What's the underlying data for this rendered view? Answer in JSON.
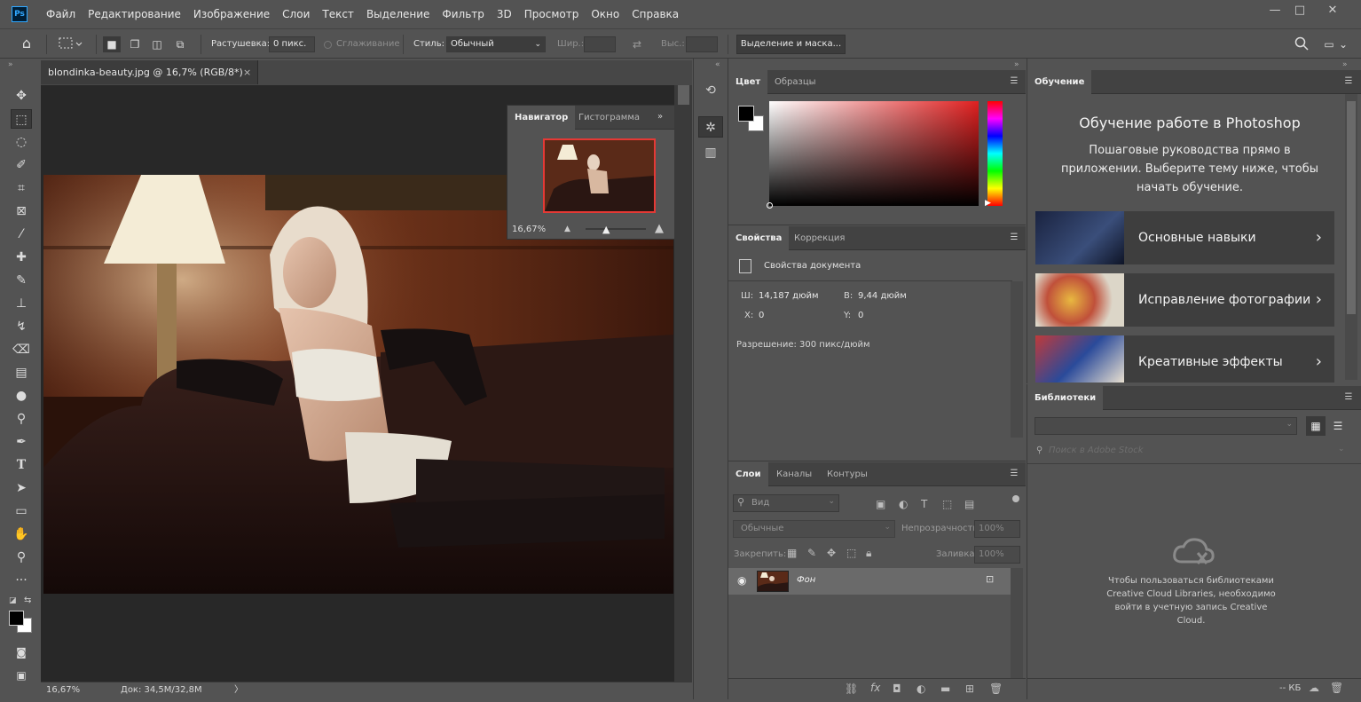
{
  "menu": {
    "logo": "Ps",
    "items": [
      "Файл",
      "Редактирование",
      "Изображение",
      "Слои",
      "Текст",
      "Выделение",
      "Фильтр",
      "3D",
      "Просмотр",
      "Окно",
      "Справка"
    ],
    "window_controls": {
      "minimize": "—",
      "maximize": "□",
      "close": "✕"
    }
  },
  "options": {
    "feather_label": "Растушевка:",
    "feather_value": "0 пикс.",
    "antialias_label": "Сглаживание",
    "style_label": "Стиль:",
    "style_value": "Обычный",
    "width_label": "Шир.:",
    "height_label": "Выс.:",
    "select_mask_button": "Выделение и маска..."
  },
  "document": {
    "tab_title": "blondinka-beauty.jpg @ 16,7% (RGB/8*)",
    "tab_close": "×",
    "zoom": "16,67%",
    "doc_size": "Док: 34,5M/32,8M",
    "status_arrow": "〉"
  },
  "navigator": {
    "tab_navigator": "Навигатор",
    "tab_histogram": "Гистограмма",
    "zoom": "16,67%",
    "expand_icon": "»"
  },
  "color_panel": {
    "tab_color": "Цвет",
    "tab_swatches": "Образцы",
    "foreground": "#000000",
    "background": "#ffffff",
    "hue": "#ff0000"
  },
  "properties": {
    "tab_properties": "Свойства",
    "tab_adjustments": "Коррекция",
    "doc_props": "Свойства документа",
    "w_label": "Ш:",
    "w_value": "14,187 дюйм",
    "h_label": "В:",
    "h_value": "9,44 дюйм",
    "x_label": "X:",
    "x_value": "0",
    "y_label": "Y:",
    "y_value": "0",
    "resolution": "Разрешение: 300 пикс/дюйм"
  },
  "layers": {
    "tab_layers": "Слои",
    "tab_channels": "Каналы",
    "tab_paths": "Контуры",
    "filter_placeholder": "Вид",
    "blend_mode": "Обычные",
    "opacity_label": "Непрозрачность:",
    "opacity_value": "100%",
    "lock_label": "Закрепить:",
    "fill_label": "Заливка:",
    "fill_value": "100%",
    "layer_name": "Фон"
  },
  "learn": {
    "tab": "Обучение",
    "heading": "Обучение работе в Photoshop",
    "subheading": "Пошаговые руководства прямо в приложении. Выберите тему ниже, чтобы начать обучение.",
    "cards": [
      "Основные навыки",
      "Исправление фотографии",
      "Креативные эффекты"
    ]
  },
  "libraries": {
    "tab": "Библиотеки",
    "search_placeholder": "Поиск в Adobe Stock",
    "message": "Чтобы пользоваться библиотеками Creative Cloud Libraries, необходимо войти в учетную запись Creative Cloud.",
    "size_indicator": "-- КБ"
  }
}
